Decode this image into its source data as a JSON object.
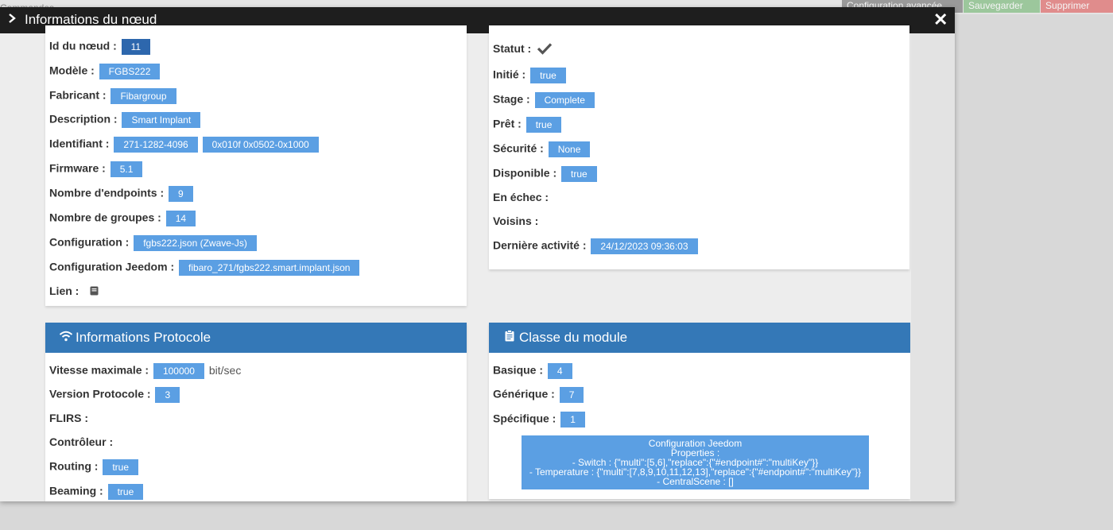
{
  "background": {
    "left_text": "Commandes",
    "adv_config_label": "Configuration avancée",
    "save_label": "Sauvegarder",
    "delete_label": "Supprimer"
  },
  "modal": {
    "title": "Informations du nœud"
  },
  "node_info": {
    "id_label": "Id du nœud :",
    "id_value": "11",
    "model_label": "Modèle :",
    "model_value": "FGBS222",
    "manufacturer_label": "Fabricant :",
    "manufacturer_value": "Fibargroup",
    "description_label": "Description :",
    "description_value": "Smart Implant",
    "identifier_label": "Identifiant :",
    "identifier_value1": "271-1282-4096",
    "identifier_value2": "0x010f 0x0502-0x1000",
    "firmware_label": "Firmware :",
    "firmware_value": "5.1",
    "endpoints_label": "Nombre d'endpoints :",
    "endpoints_value": "9",
    "groups_label": "Nombre de groupes :",
    "groups_value": "14",
    "config_label": "Configuration :",
    "config_value": "fgbs222.json (Zwave-Js)",
    "jeedom_config_label": "Configuration Jeedom :",
    "jeedom_config_value": "fibaro_271/fgbs222.smart.implant.json",
    "link_label": "Lien :"
  },
  "status_info": {
    "status_label": "Statut :",
    "initiated_label": "Initié :",
    "initiated_value": "true",
    "stage_label": "Stage :",
    "stage_value": "Complete",
    "ready_label": "Prêt :",
    "ready_value": "true",
    "security_label": "Sécurité :",
    "security_value": "None",
    "available_label": "Disponible :",
    "available_value": "true",
    "failed_label": "En échec :",
    "neighbors_label": "Voisins :",
    "last_activity_label": "Dernière activité :",
    "last_activity_value": "24/12/2023 09:36:03"
  },
  "protocol": {
    "title": "Informations Protocole",
    "max_speed_label": "Vitesse maximale :",
    "max_speed_value": "100000",
    "max_speed_unit": "bit/sec",
    "protocol_version_label": "Version Protocole :",
    "protocol_version_value": "3",
    "flirs_label": "FLIRS :",
    "controller_label": "Contrôleur :",
    "routing_label": "Routing :",
    "routing_value": "true",
    "beaming_label": "Beaming :",
    "beaming_value": "true"
  },
  "module_class": {
    "title": "Classe du module",
    "basic_label": "Basique :",
    "basic_value": "4",
    "generic_label": "Générique :",
    "generic_value": "7",
    "specific_label": "Spécifique :",
    "specific_value": "1",
    "config_box": {
      "line1": "Configuration Jeedom",
      "line2": "Properties :",
      "line3": "- Switch : {\"multi\":[5,6],\"replace\":{\"#endpoint#\":\"multiKey\"}}",
      "line4": "- Temperature : {\"multi\":[7,8,9,10,11,12,13],\"replace\":{\"#endpoint#\":\"multiKey\"}}",
      "line5": "- CentralScene : []"
    }
  },
  "icons": {
    "chevron": "chevron-right-icon",
    "close": "close-icon",
    "check": "check-icon",
    "book": "book-icon",
    "wifi": "wifi-icon",
    "clipboard": "clipboard-icon"
  },
  "colors": {
    "header_bg": "#1e1e1e",
    "panel_head": "#3478b7",
    "badge": "#5b9fe3",
    "badge_dark": "#2d67ad"
  }
}
